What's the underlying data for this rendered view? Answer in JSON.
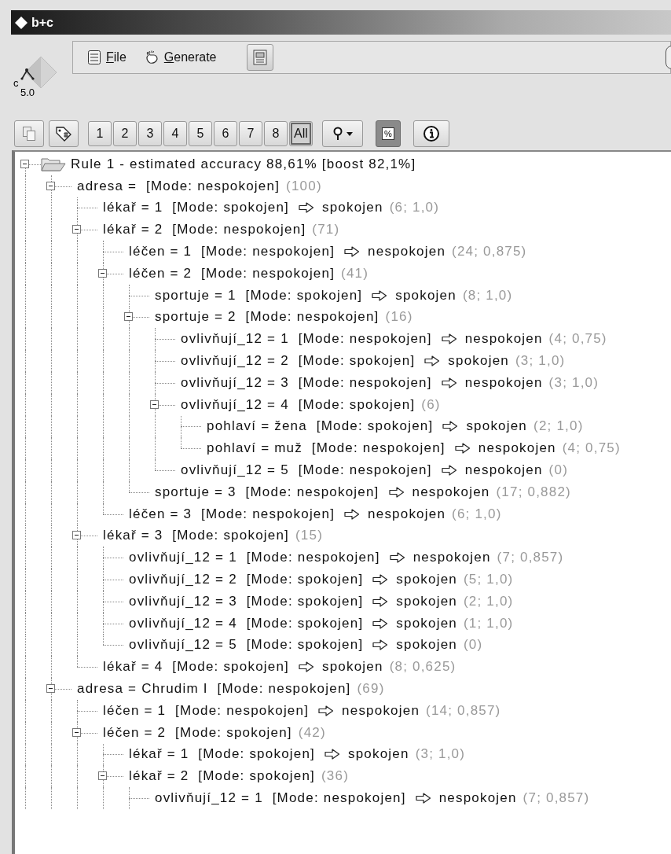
{
  "window": {
    "title": "b+c"
  },
  "logo": {
    "prefix": "c",
    "version": "5.0"
  },
  "menu": [
    {
      "key": "F",
      "rest": "ile",
      "kind": "file"
    },
    {
      "key": "G",
      "rest": "enerate",
      "kind": "generate"
    }
  ],
  "toolbar": {
    "tools": [
      {
        "kind": "copy"
      },
      {
        "kind": "tag"
      }
    ],
    "depths": [
      {
        "label": "1",
        "selected": false
      },
      {
        "label": "2",
        "selected": false
      },
      {
        "label": "3",
        "selected": false
      },
      {
        "label": "4",
        "selected": false
      },
      {
        "label": "5",
        "selected": false
      },
      {
        "label": "6",
        "selected": false
      },
      {
        "label": "7",
        "selected": false
      },
      {
        "label": "8",
        "selected": false
      },
      {
        "label": "All",
        "selected": true
      }
    ],
    "percent": {
      "label": "%",
      "on": true
    }
  },
  "tree": {
    "text": "Rule 1 - estimated accuracy 88,61% [boost 82,1%]",
    "expanded": true,
    "children": [
      {
        "condition": "adresa =",
        "mode": "[Mode: nespokojen]",
        "stats": "(100)",
        "expanded": true,
        "children": [
          {
            "condition": "lékař = 1",
            "mode": "[Mode: spokojen]",
            "prediction": "spokojen",
            "stats": "(6; 1,0)"
          },
          {
            "condition": "lékař = 2",
            "mode": "[Mode: nespokojen]",
            "stats": "(71)",
            "expanded": true,
            "children": [
              {
                "condition": "léčen = 1",
                "mode": "[Mode: nespokojen]",
                "prediction": "nespokojen",
                "stats": "(24; 0,875)"
              },
              {
                "condition": "léčen = 2",
                "mode": "[Mode: nespokojen]",
                "stats": "(41)",
                "expanded": true,
                "children": [
                  {
                    "condition": "sportuje = 1",
                    "mode": "[Mode: spokojen]",
                    "prediction": "spokojen",
                    "stats": "(8; 1,0)"
                  },
                  {
                    "condition": "sportuje = 2",
                    "mode": "[Mode: nespokojen]",
                    "stats": "(16)",
                    "expanded": true,
                    "children": [
                      {
                        "condition": "ovlivňují_12 = 1",
                        "mode": "[Mode: nespokojen]",
                        "prediction": "nespokojen",
                        "stats": "(4; 0,75)"
                      },
                      {
                        "condition": "ovlivňují_12 = 2",
                        "mode": "[Mode: spokojen]",
                        "prediction": "spokojen",
                        "stats": "(3; 1,0)"
                      },
                      {
                        "condition": "ovlivňují_12 = 3",
                        "mode": "[Mode: nespokojen]",
                        "prediction": "nespokojen",
                        "stats": "(3; 1,0)"
                      },
                      {
                        "condition": "ovlivňují_12 = 4",
                        "mode": "[Mode: spokojen]",
                        "stats": "(6)",
                        "expanded": true,
                        "children": [
                          {
                            "condition": "pohlaví = žena",
                            "mode": "[Mode: spokojen]",
                            "prediction": "spokojen",
                            "stats": "(2; 1,0)"
                          },
                          {
                            "condition": "pohlaví = muž",
                            "mode": "[Mode: nespokojen]",
                            "prediction": "nespokojen",
                            "stats": "(4; 0,75)"
                          }
                        ]
                      },
                      {
                        "condition": "ovlivňují_12 = 5",
                        "mode": "[Mode: nespokojen]",
                        "prediction": "nespokojen",
                        "stats": "(0)"
                      }
                    ]
                  },
                  {
                    "condition": "sportuje = 3",
                    "mode": "[Mode: nespokojen]",
                    "prediction": "nespokojen",
                    "stats": "(17; 0,882)"
                  }
                ]
              },
              {
                "condition": "léčen = 3",
                "mode": "[Mode: nespokojen]",
                "prediction": "nespokojen",
                "stats": "(6; 1,0)"
              }
            ]
          },
          {
            "condition": "lékař = 3",
            "mode": "[Mode: spokojen]",
            "stats": "(15)",
            "expanded": true,
            "children": [
              {
                "condition": "ovlivňují_12 = 1",
                "mode": "[Mode: nespokojen]",
                "prediction": "nespokojen",
                "stats": "(7; 0,857)"
              },
              {
                "condition": "ovlivňují_12 = 2",
                "mode": "[Mode: spokojen]",
                "prediction": "spokojen",
                "stats": "(5; 1,0)"
              },
              {
                "condition": "ovlivňují_12 = 3",
                "mode": "[Mode: spokojen]",
                "prediction": "spokojen",
                "stats": "(2; 1,0)"
              },
              {
                "condition": "ovlivňují_12 = 4",
                "mode": "[Mode: spokojen]",
                "prediction": "spokojen",
                "stats": "(1; 1,0)"
              },
              {
                "condition": "ovlivňují_12 = 5",
                "mode": "[Mode: spokojen]",
                "prediction": "spokojen",
                "stats": "(0)"
              }
            ]
          },
          {
            "condition": "lékař = 4",
            "mode": "[Mode: spokojen]",
            "prediction": "spokojen",
            "stats": "(8; 0,625)"
          }
        ]
      },
      {
        "condition": "adresa = Chrudim I",
        "mode": "[Mode: nespokojen]",
        "stats": "(69)",
        "expanded": true,
        "children": [
          {
            "condition": "léčen = 1",
            "mode": "[Mode: nespokojen]",
            "prediction": "nespokojen",
            "stats": "(14; 0,857)"
          },
          {
            "condition": "léčen = 2",
            "mode": "[Mode: spokojen]",
            "stats": "(42)",
            "expanded": true,
            "children": [
              {
                "condition": "lékař = 1",
                "mode": "[Mode: spokojen]",
                "prediction": "spokojen",
                "stats": "(3; 1,0)"
              },
              {
                "condition": "lékař = 2",
                "mode": "[Mode: spokojen]",
                "stats": "(36)",
                "expanded": true,
                "children": [
                  {
                    "condition": "ovlivňují_12 = 1",
                    "mode": "[Mode: nespokojen]",
                    "prediction": "nespokojen",
                    "stats": "(7; 0,857)"
                  }
                ]
              }
            ]
          }
        ]
      }
    ]
  }
}
